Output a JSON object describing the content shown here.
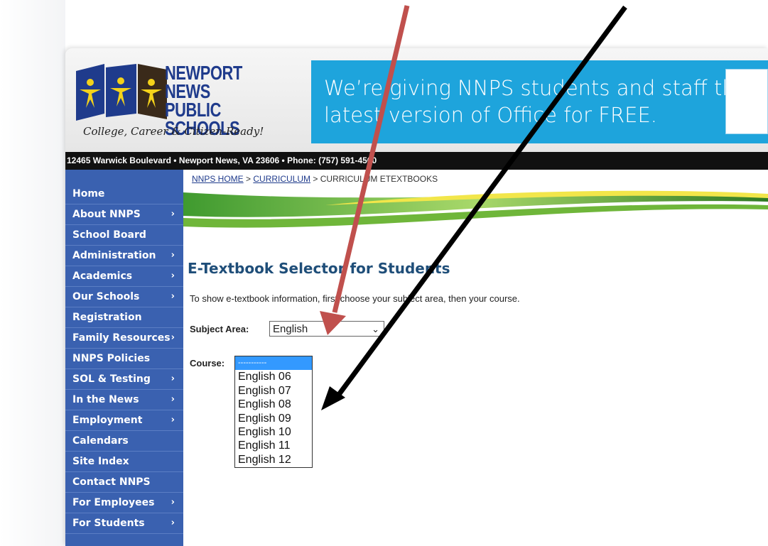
{
  "logo": {
    "name_line1": "NEWPORT NEWS",
    "name_line2": "PUBLIC SCHOOLS",
    "tagline": "College, Career & Citizen-Ready!"
  },
  "banner": {
    "line1": "We’re giving NNPS students and staff the",
    "line2": "latest version of Office for FREE."
  },
  "address_bar": "12465 Warwick Boulevard  •  Newport News, VA 23606  •  Phone: (757) 591-4500",
  "breadcrumb": {
    "home": "NNPS HOME",
    "sep1": " > ",
    "curriculum": "CURRICULUM",
    "sep2": " > ",
    "current": "CURRICULUM ETEXTBOOKS"
  },
  "nav": {
    "items": [
      {
        "label": "Home",
        "chevron": ""
      },
      {
        "label": "About NNPS",
        "chevron": "›"
      },
      {
        "label": "School Board",
        "chevron": ""
      },
      {
        "label": "Administration",
        "chevron": "›"
      },
      {
        "label": "Academics",
        "chevron": "›"
      },
      {
        "label": "Our Schools",
        "chevron": "›"
      },
      {
        "label": "Registration",
        "chevron": ""
      },
      {
        "label": "Family Resources",
        "chevron": "›"
      },
      {
        "label": "NNPS Policies",
        "chevron": ""
      },
      {
        "label": "SOL & Testing",
        "chevron": "›"
      },
      {
        "label": "In the News",
        "chevron": "›"
      },
      {
        "label": "Employment",
        "chevron": "›"
      },
      {
        "label": "Calendars",
        "chevron": ""
      },
      {
        "label": "Site Index",
        "chevron": ""
      },
      {
        "label": "Contact NNPS",
        "chevron": ""
      },
      {
        "label": "For Employees",
        "chevron": "›"
      },
      {
        "label": "For Students",
        "chevron": "›"
      }
    ]
  },
  "main": {
    "title": "E-Textbook Selector for Students",
    "intro": "To show e-textbook information, first choose your subject area, then your course.",
    "subject_label": "Subject Area:",
    "subject_value": "English",
    "subject_dropdown_icon": "chevron-down-icon",
    "course_label": "Course:",
    "course_options": [
      "-----------",
      "English 06",
      "English 07",
      "English 08",
      "English 09",
      "English 10",
      "English 11",
      "English 12"
    ]
  },
  "colors": {
    "nav_bg": "#3a61b0",
    "banner_bg": "#1ea4dc",
    "title": "#1f4e79",
    "arrow_red": "#c0504d",
    "arrow_black": "#000000",
    "selected_option": "#3399ff"
  }
}
